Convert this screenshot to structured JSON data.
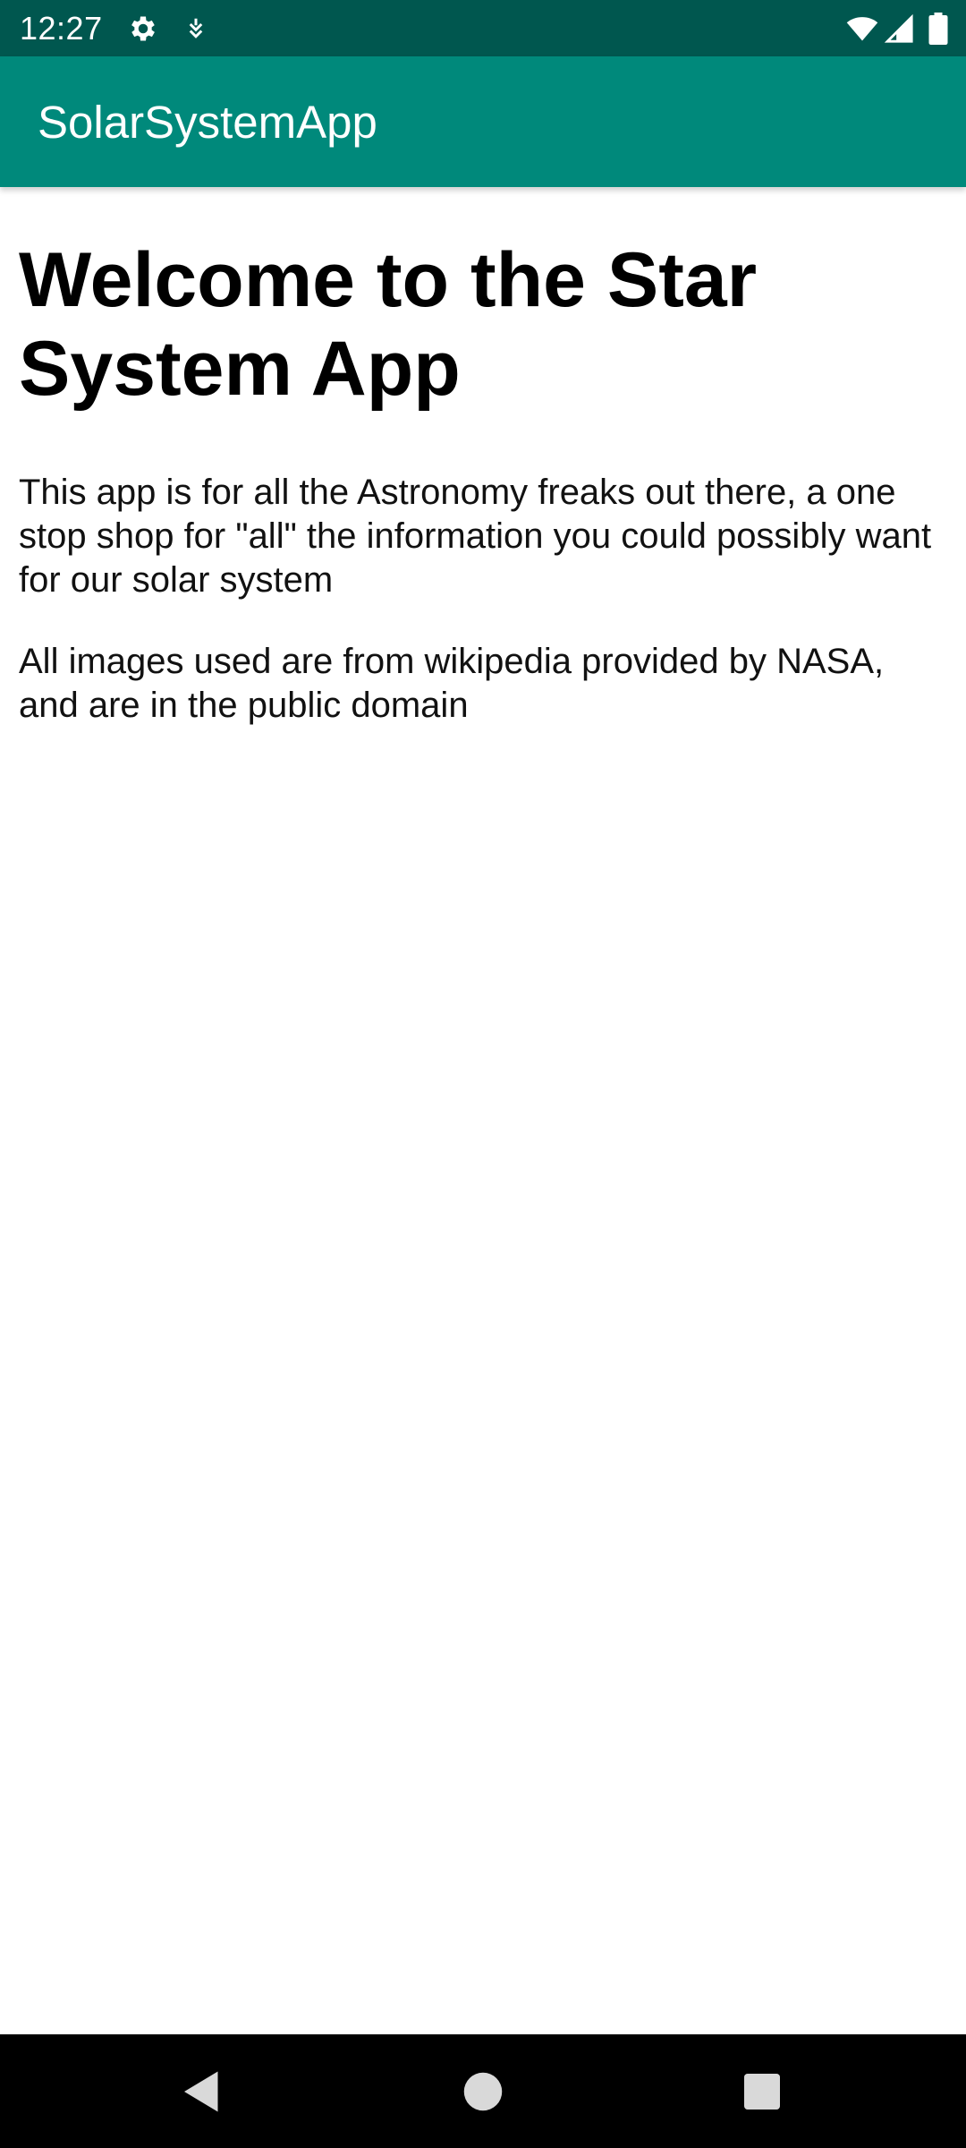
{
  "status_bar": {
    "time": "12:27",
    "icons": [
      "gear-icon",
      "download-icon",
      "wifi-icon",
      "signal-icon",
      "battery-icon"
    ]
  },
  "app_bar": {
    "title": "SolarSystemApp"
  },
  "content": {
    "heading": "Welcome to the Star System App",
    "description": "This app is for all the Astronomy freaks out there, a one stop shop for \"all\" the information you could possibly want for our solar system",
    "attribution": "All images used are from wikipedia provided by NASA, and are in the public domain"
  },
  "nav_bar": {
    "buttons": [
      "back-icon",
      "home-icon",
      "recents-icon"
    ]
  },
  "colors": {
    "status_bar": "#00574f",
    "app_bar": "#00897b",
    "background": "#ffffff",
    "nav_bar": "#000000"
  }
}
